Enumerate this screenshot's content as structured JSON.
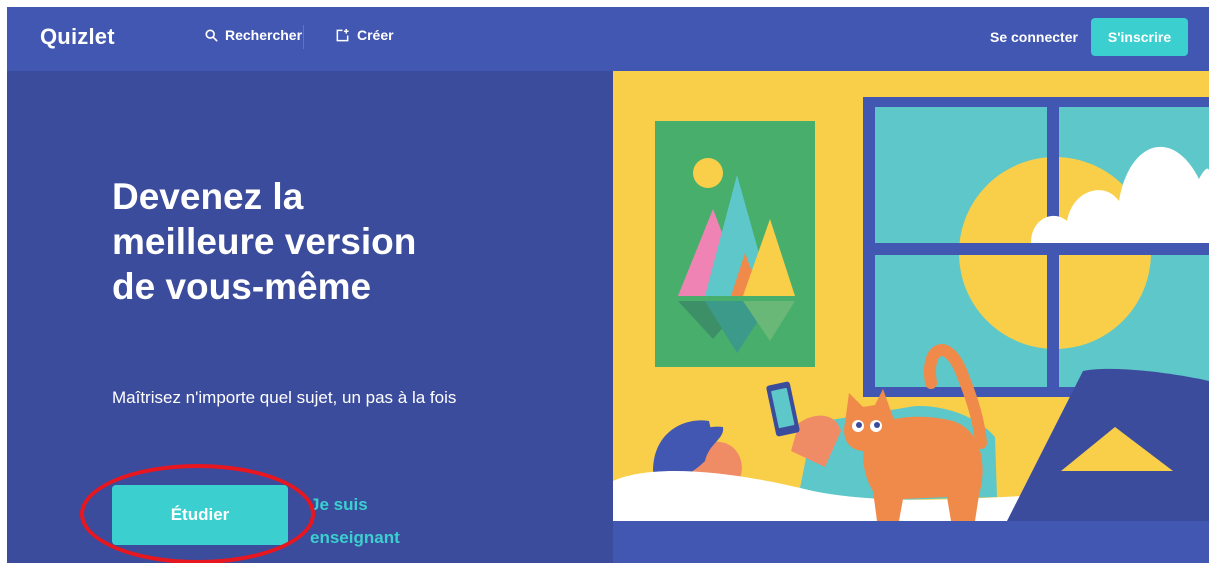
{
  "header": {
    "logo": "Quizlet",
    "search_label": "Rechercher",
    "create_label": "Créer",
    "login_label": "Se connecter",
    "signup_label": "S'inscrire"
  },
  "hero": {
    "headline_lines": [
      "Devenez la",
      "meilleure version",
      "de vous-même"
    ],
    "subtitle": "Maîtrisez n'importe quel sujet, un pas à la fois",
    "study_button": "Étudier",
    "teacher_link_lines": [
      "Je suis",
      "enseignant"
    ]
  },
  "colors": {
    "header_bg": "#4257b2",
    "hero_bg": "#3c4c9c",
    "accent": "#3ccfcf",
    "highlight": "#e8161e",
    "illustration_wall": "#f9cf49"
  }
}
